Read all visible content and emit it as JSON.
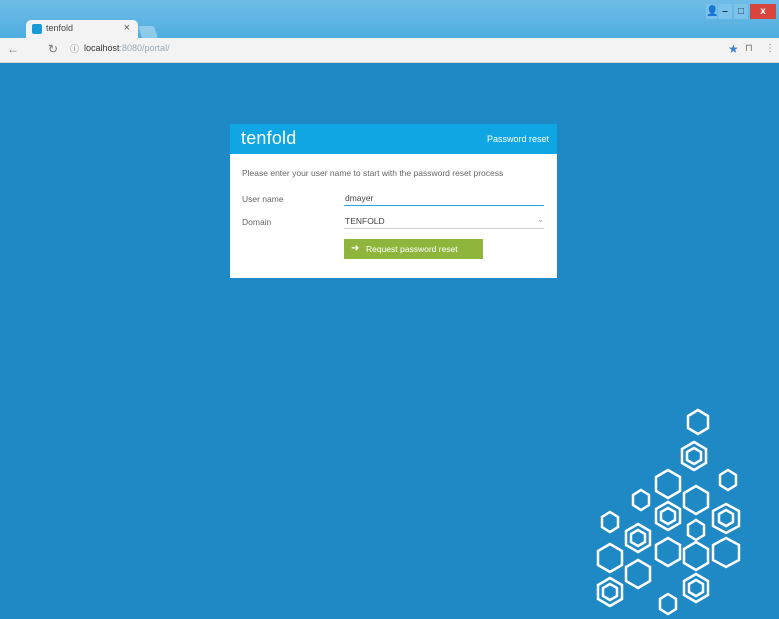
{
  "browser": {
    "tab_title": "tenfold",
    "tab_close": "×",
    "url_host": "localhost",
    "url_path": ":8080/portal/",
    "window_controls": {
      "user": "👤",
      "minimize": "–",
      "maximize": "□",
      "close": "x"
    },
    "icons": [
      "back-icon",
      "reload-icon",
      "info-icon",
      "star-icon",
      "extension-icon",
      "menu-icon"
    ]
  },
  "card": {
    "brand": "tenfold",
    "header_title": "Password reset",
    "intro": "Please enter your user name to start with the password reset process",
    "fields": {
      "user_label": "User name",
      "user_value": "dmayer",
      "domain_label": "Domain",
      "domain_value": "TENFOLD"
    },
    "button_label": "Request password reset"
  },
  "colors": {
    "background": "#1f89c6",
    "header": "#0fa6e3",
    "button": "#8fb53c"
  }
}
